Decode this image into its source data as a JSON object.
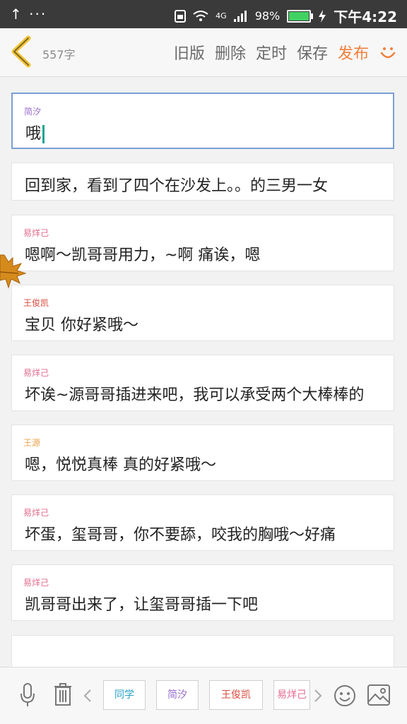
{
  "status_bar": {
    "left": "↑ ···",
    "network": "4G",
    "battery_percent": "98%",
    "time": "下午4:22",
    "battery_level": 0.98
  },
  "header": {
    "word_count": "557字",
    "actions": [
      "旧版",
      "删除",
      "定时",
      "保存",
      "发布"
    ]
  },
  "lines": [
    {
      "speaker": "简汐",
      "speaker_color": "#9a6ccf",
      "text": "哦",
      "active": true
    },
    {
      "speaker": "",
      "speaker_color": "",
      "text": "回到家，看到了四个在沙发上。。的三男一女"
    },
    {
      "speaker": "易烊己",
      "speaker_color": "#e56a8c",
      "text": "嗯啊～凯哥哥用力，~啊 痛诶，嗯"
    },
    {
      "speaker": "王俊凯",
      "speaker_color": "#d94b3e",
      "text": "宝贝 你好紧哦～"
    },
    {
      "speaker": "易烊己",
      "speaker_color": "#e56a8c",
      "text": "坏诶~源哥哥插进来吧，我可以承受两个大棒棒的"
    },
    {
      "speaker": "王源",
      "speaker_color": "#f0a24a",
      "text": "嗯，悦悦真棒 真的好紧哦～"
    },
    {
      "speaker": "易烊己",
      "speaker_color": "#e56a8c",
      "text": "坏蛋，玺哥哥，你不要舔，咬我的胸哦～好痛"
    },
    {
      "speaker": "易烊己",
      "speaker_color": "#e56a8c",
      "text": "凯哥哥出来了，让玺哥哥插一下吧"
    },
    {
      "speaker": "",
      "speaker_color": "",
      "text": ""
    }
  ],
  "toolbar": {
    "chips": [
      {
        "label": "同学",
        "color": "#27a0c9"
      },
      {
        "label": "简汐",
        "color": "#9a6ccf"
      },
      {
        "label": "王俊凯",
        "color": "#d94b3e"
      },
      {
        "label": "易烊己",
        "color": "#e56a8c"
      }
    ],
    "icons": [
      "microphone-icon",
      "trash-icon",
      "chevron-left-icon",
      "chevron-right-icon",
      "emoji-icon",
      "image-icon"
    ]
  }
}
